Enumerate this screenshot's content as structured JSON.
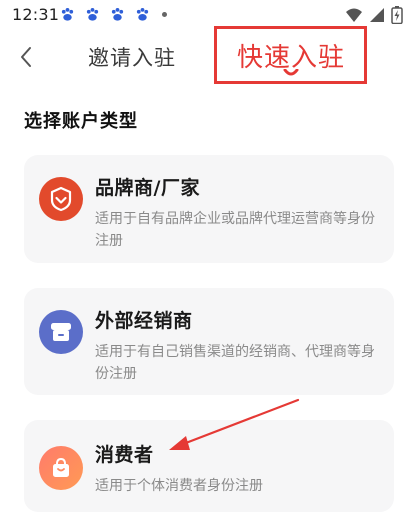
{
  "status_bar": {
    "time": "12:31"
  },
  "header": {
    "title": "邀请入驻",
    "highlight_label": "快速入驻"
  },
  "section_title": "选择账户类型",
  "account_types": [
    {
      "title": "品牌商/厂家",
      "description": "适用于自有品牌企业或品牌代理运营商等身份注册",
      "icon": "brand-badge-icon",
      "color": "#e24a2c"
    },
    {
      "title": "外部经销商",
      "description": "适用于有自己销售渠道的经销商、代理商等身份注册",
      "icon": "store-icon",
      "color": "#5b6ec9"
    },
    {
      "title": "消费者",
      "description": "适用于个体消费者身份注册",
      "icon": "shopping-bag-icon",
      "color": "#ff8a5f"
    }
  ],
  "colors": {
    "annotation": "#e53935",
    "card_bg": "#f6f6f7",
    "muted_text": "#8a8a8a"
  }
}
